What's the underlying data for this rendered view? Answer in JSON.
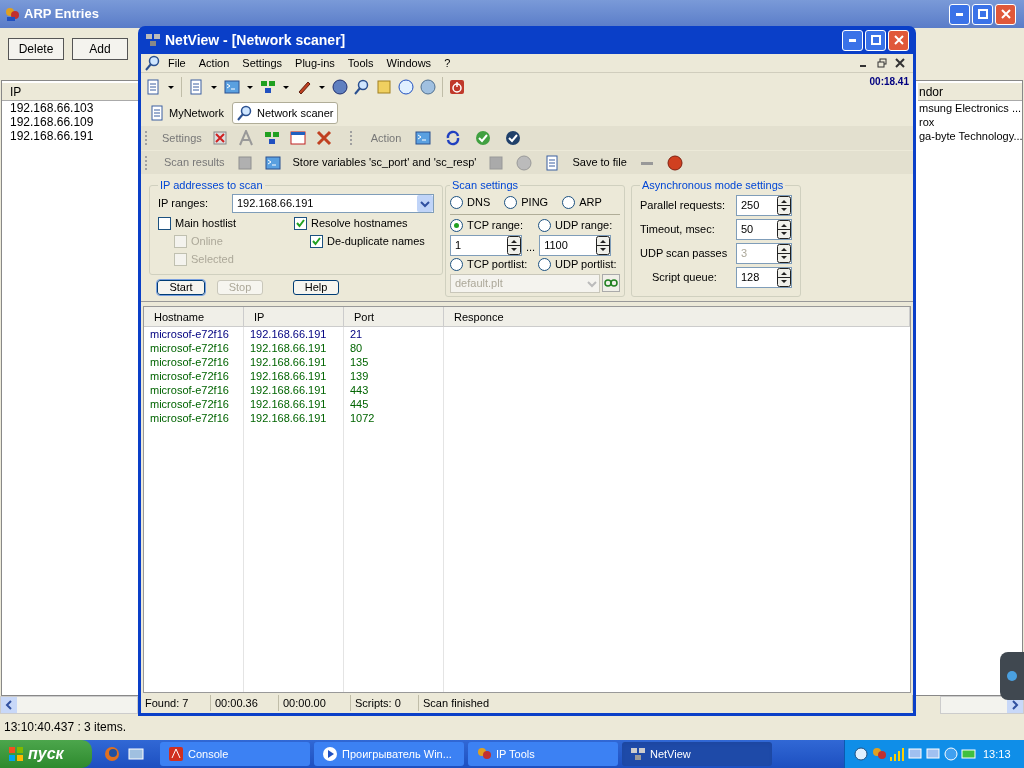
{
  "arp_window": {
    "title": "ARP Entries",
    "buttons": [
      "Delete",
      "Add"
    ],
    "columns": [
      "IP",
      "ndor"
    ],
    "rows": [
      {
        "ip": "192.168.66.103",
        "vendor": "msung Electronics ..."
      },
      {
        "ip": "192.168.66.109",
        "vendor": "rox"
      },
      {
        "ip": "192.168.66.191",
        "vendor": "ga-byte Technology..."
      }
    ],
    "status": "13:10:40.437 : 3 items."
  },
  "netview": {
    "title": "NetView - [Network scaner]",
    "menu": [
      "File",
      "Action",
      "Settings",
      "Plug-ins",
      "Tools",
      "Windows",
      "?"
    ],
    "timer": "00:18.41",
    "tabs": [
      {
        "label": "MyNetwork",
        "selected": false
      },
      {
        "label": "Network scaner",
        "selected": true
      }
    ],
    "settings_toolbar": "Settings",
    "action_toolbar": "Action",
    "results_toolbar": {
      "label": "Scan results",
      "store": "Store variables 'sc_port' and 'sc_resp'",
      "save": "Save to file"
    },
    "ip_group": {
      "title": "IP addresses to scan",
      "ranges_label": "IP ranges:",
      "ranges": "192.168.66.191",
      "options": [
        {
          "label": "Main hostlist",
          "checked": false,
          "disabled": false,
          "children": [
            {
              "label": "Online",
              "checked": false,
              "disabled": true
            },
            {
              "label": "Selected",
              "checked": false,
              "disabled": true
            }
          ]
        },
        {
          "label": "Resolve hostnames",
          "checked": true,
          "disabled": false,
          "children": [
            {
              "label": "De-duplicate names",
              "checked": true,
              "disabled": false
            }
          ]
        }
      ],
      "buttons": [
        {
          "label": "Start",
          "disabled": false,
          "focused": true
        },
        {
          "label": "Stop",
          "disabled": true,
          "focused": false
        },
        {
          "label": "Help",
          "disabled": false,
          "focused": false
        }
      ]
    },
    "scan_settings": {
      "title": "Scan settings",
      "modes": [
        {
          "label": "DNS",
          "selected": false
        },
        {
          "label": "PING",
          "selected": false
        },
        {
          "label": "ARP",
          "selected": false
        }
      ],
      "port_modes": [
        {
          "label": "TCP range:",
          "selected": true
        },
        {
          "label": "UDP range:",
          "selected": false
        },
        {
          "label": "TCP portlist:",
          "selected": false
        },
        {
          "label": "UDP portlist:",
          "selected": false
        }
      ],
      "range_from": "1",
      "range_separator": "...",
      "range_to": "1100",
      "portlist": "default.plt"
    },
    "async_settings": {
      "title": "Asynchronous mode settings",
      "fields": [
        {
          "label": "Parallel requests:",
          "value": "250",
          "disabled": false
        },
        {
          "label": "Timeout, msec:",
          "value": "50",
          "disabled": false
        },
        {
          "label": "UDP scan passes",
          "value": "3",
          "disabled": true
        },
        {
          "label": "Script queue:",
          "value": "128",
          "disabled": false
        }
      ]
    },
    "table": {
      "columns": [
        "Hostname",
        "IP",
        "Port",
        "Responce"
      ],
      "rows": [
        {
          "cells": [
            "microsof-e72f16",
            "192.168.66.191",
            "21"
          ],
          "color": "#000080"
        },
        {
          "cells": [
            "microsof-e72f16",
            "192.168.66.191",
            "80"
          ],
          "color": "#006400"
        },
        {
          "cells": [
            "microsof-e72f16",
            "192.168.66.191",
            "135"
          ],
          "color": "#006400"
        },
        {
          "cells": [
            "microsof-e72f16",
            "192.168.66.191",
            "139"
          ],
          "color": "#006400"
        },
        {
          "cells": [
            "microsof-e72f16",
            "192.168.66.191",
            "443"
          ],
          "color": "#006400"
        },
        {
          "cells": [
            "microsof-e72f16",
            "192.168.66.191",
            "445"
          ],
          "color": "#006400"
        },
        {
          "cells": [
            "microsof-e72f16",
            "192.168.66.191",
            "1072"
          ],
          "color": "#006400"
        }
      ]
    },
    "status_bar": [
      "Found: 7",
      "00:00.36",
      "00:00.00",
      "Scripts: 0",
      "Scan finished"
    ]
  },
  "taskbar": {
    "start": "пуск",
    "tasks": [
      {
        "label": "Console",
        "selected": false
      },
      {
        "label": "Проигрыватель Win...",
        "selected": false
      },
      {
        "label": "IP Tools",
        "selected": false
      },
      {
        "label": "NetView",
        "selected": true
      }
    ],
    "clock": "13:13"
  }
}
